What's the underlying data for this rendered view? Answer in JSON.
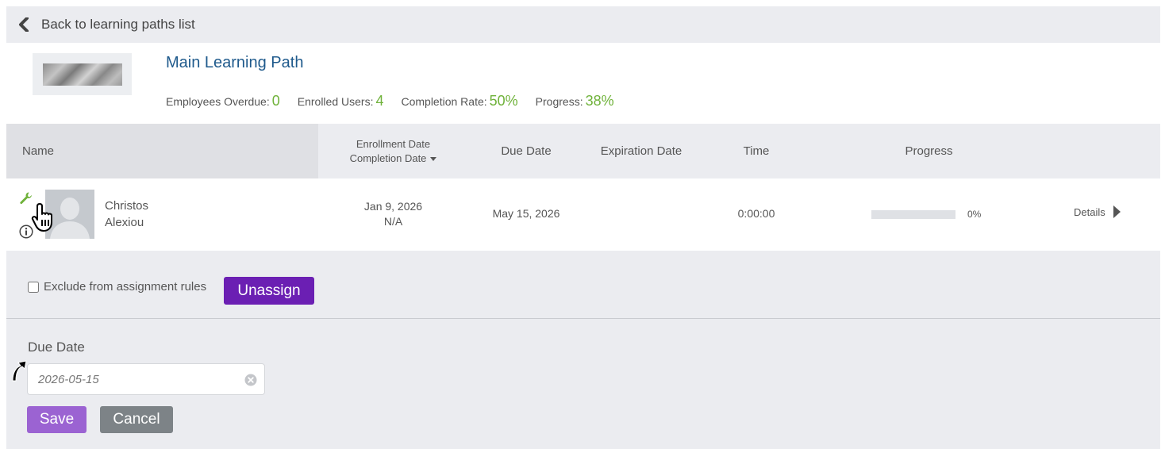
{
  "back": {
    "label": "Back to learning paths list",
    "icon": "chevron-left-icon"
  },
  "path": {
    "title": "Main Learning Path",
    "stats": [
      {
        "label": "Employees Overdue:",
        "value": "0"
      },
      {
        "label": "Enrolled Users:",
        "value": "4"
      },
      {
        "label": "Completion Rate:",
        "value": "50%"
      },
      {
        "label": "Progress:",
        "value": "38%"
      }
    ]
  },
  "table": {
    "headers": {
      "name": "Name",
      "enrollment_date": "Enrollment Date",
      "completion_date": "Completion Date",
      "due_date": "Due Date",
      "expiration_date": "Expiration Date",
      "time": "Time",
      "progress": "Progress"
    },
    "rows": [
      {
        "first_name": "Christos",
        "last_name": "Alexiou",
        "enrollment_date": "Jan 9, 2026",
        "completion_date": "N/A",
        "due_date": "May 15, 2026",
        "expiration_date": "",
        "time": "0:00:00",
        "progress_value": 0,
        "progress_text": "0%",
        "details_label": "Details"
      }
    ]
  },
  "assignment": {
    "exclude_label": "Exclude from assignment rules",
    "exclude_checked": false,
    "unassign_label": "Unassign"
  },
  "due_editor": {
    "label": "Due Date",
    "value": "2026-05-15",
    "save_label": "Save",
    "cancel_label": "Cancel"
  },
  "colors": {
    "accent_green": "#6fb23a",
    "title_blue": "#1f5a8c",
    "unassign_purple": "#6b1fb3",
    "save_purple": "#9b63d2",
    "cancel_gray": "#7d8387"
  }
}
